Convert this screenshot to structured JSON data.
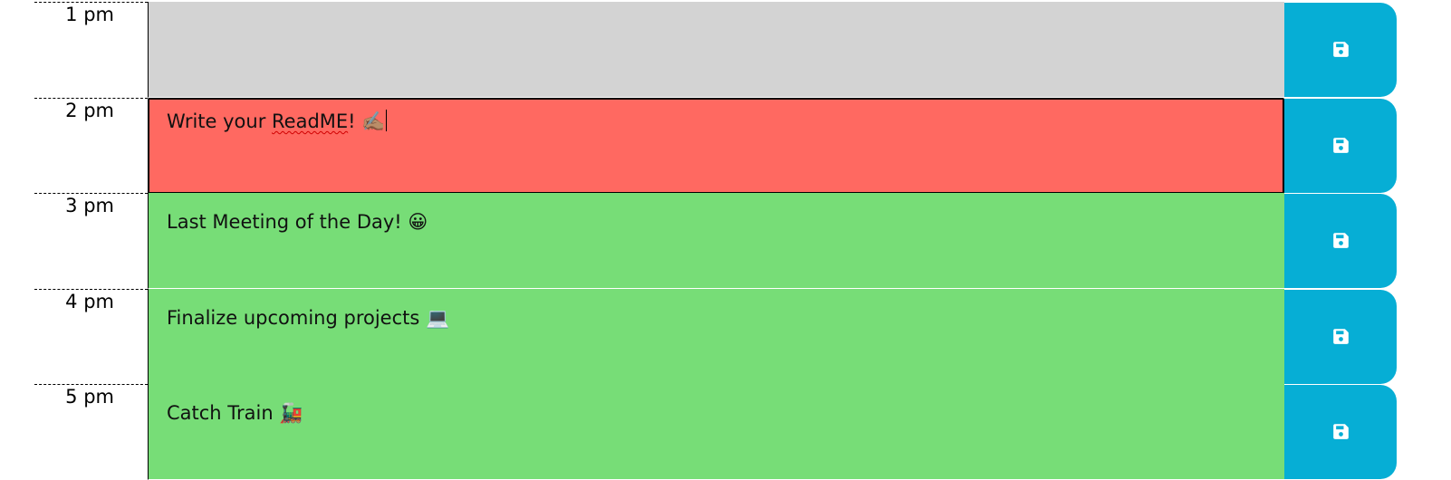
{
  "colors": {
    "past": "#d3d3d3",
    "present": "#ff6961",
    "future": "#77dd77",
    "save_button": "#06aed5"
  },
  "rows": [
    {
      "hour": "1 pm",
      "state": "past",
      "text": "",
      "save_icon": "save-icon"
    },
    {
      "hour": "2 pm",
      "state": "present",
      "text_before": "Write your ",
      "text_misspelled": "ReadME",
      "text_after": "! ✍🏽",
      "save_icon": "save-icon"
    },
    {
      "hour": "3 pm",
      "state": "future",
      "text": "Last Meeting of the Day! 😀",
      "save_icon": "save-icon"
    },
    {
      "hour": "4 pm",
      "state": "future",
      "text": "Finalize upcoming projects 💻",
      "save_icon": "save-icon"
    },
    {
      "hour": "5 pm",
      "state": "future",
      "text": "Catch Train 🚂",
      "save_icon": "save-icon"
    }
  ]
}
